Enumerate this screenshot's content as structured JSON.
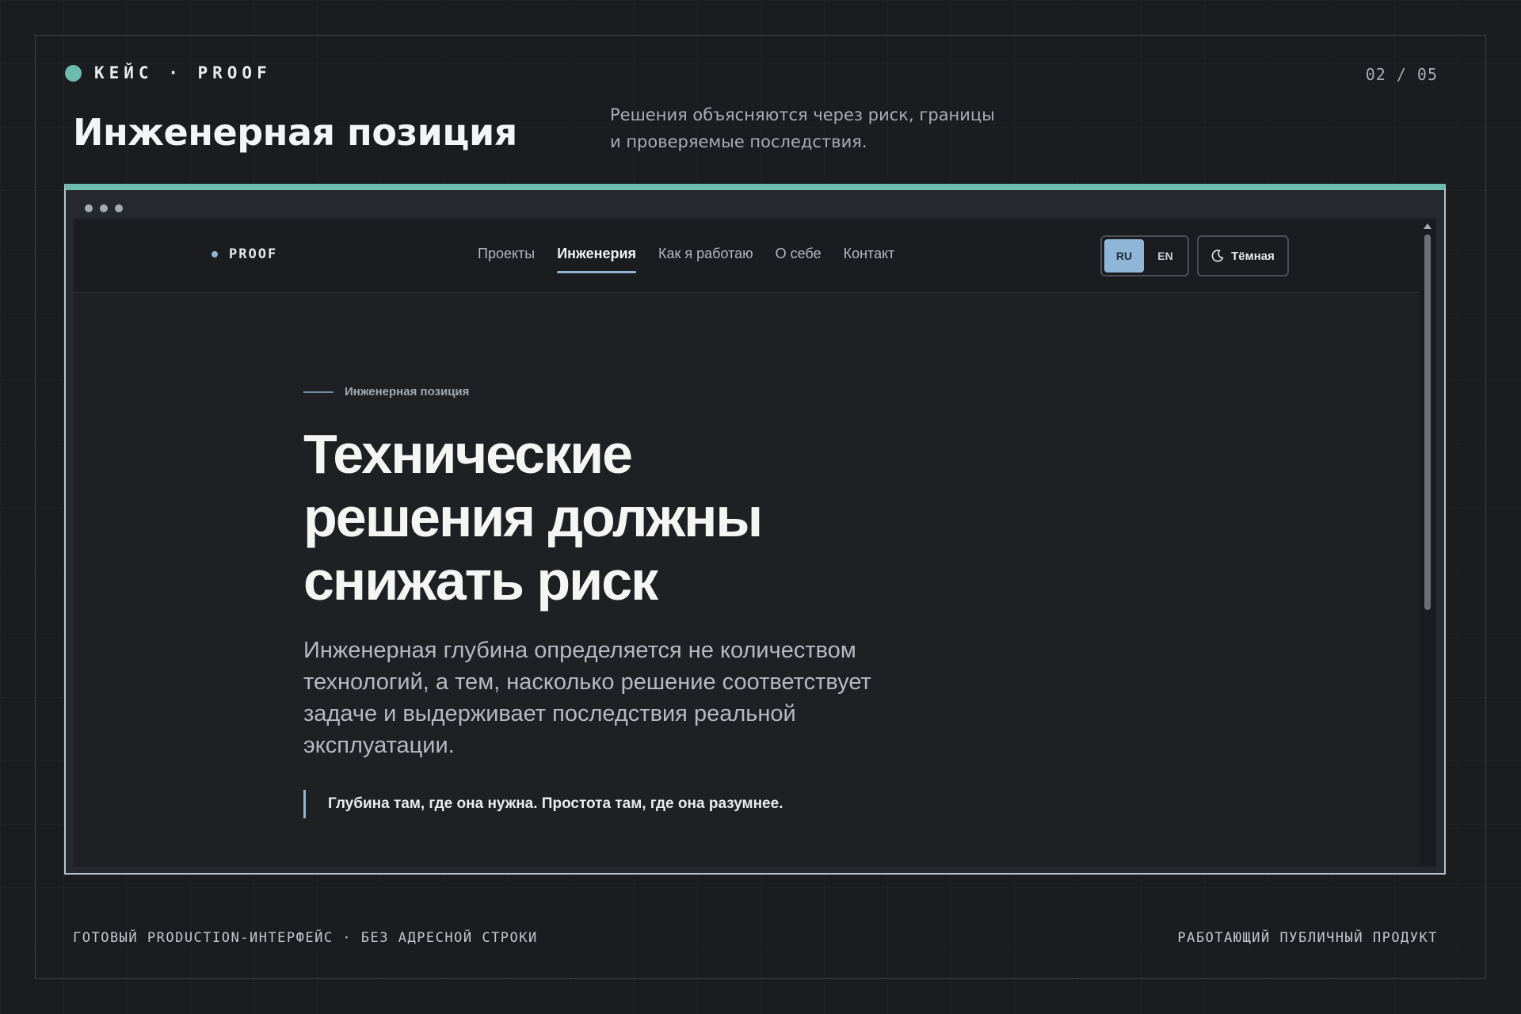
{
  "slide": {
    "kicker": "КЕЙС · PROOF",
    "counter": "02 / 05",
    "title": "Инженерная позиция",
    "subtitle_line1": "Решения объясняются через риск, границы",
    "subtitle_line2": "и проверяемые последствия.",
    "accent_color": "#6cbcb0",
    "footer_left": "ГОТОВЫЙ PRODUCTION-ИНТЕРФЕЙС · БЕЗ АДРЕСНОЙ СТРОКИ",
    "footer_right": "РАБОТАЮЩИЙ ПУБЛИЧНЫЙ ПРОДУКТ"
  },
  "site": {
    "logo": "PROOF",
    "nav": [
      {
        "label": "Проекты",
        "active": false
      },
      {
        "label": "Инженерия",
        "active": true
      },
      {
        "label": "Как я работаю",
        "active": false
      },
      {
        "label": "О себе",
        "active": false
      },
      {
        "label": "Контакт",
        "active": false
      }
    ],
    "lang": {
      "ru": "RU",
      "en": "EN",
      "selected": "RU"
    },
    "theme_label": "Тёмная",
    "theme_icon": "moon-icon",
    "accent_color": "#8fb6d6",
    "hero": {
      "eyebrow": "Инженерная позиция",
      "heading": "Технические решения должны снижать риск",
      "lead": "Инженерная глубина определяется не количеством технологий, а тем, насколько решение соответствует задаче и выдерживает последствия реальной эксплуатации.",
      "quote": "Глубина там, где она нужна. Простота там, где она разумнее."
    }
  }
}
